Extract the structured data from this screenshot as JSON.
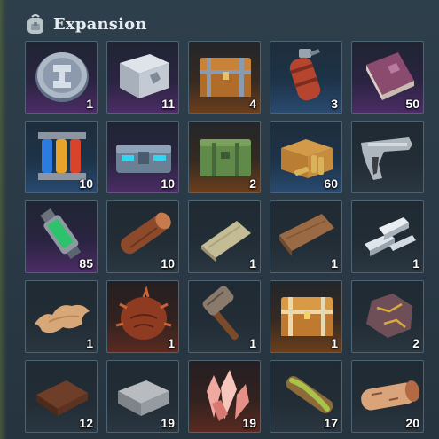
{
  "header": {
    "title": "Expansion",
    "icon": "backpack-icon"
  },
  "items": [
    {
      "name": "platinum-coin",
      "icon": "coin-icon",
      "qty": "1",
      "rarity": "purple"
    },
    {
      "name": "metal-supply-crate",
      "icon": "metal-crate-icon",
      "qty": "11",
      "rarity": "purple"
    },
    {
      "name": "wooden-chest",
      "icon": "wooden-chest-icon",
      "qty": "4",
      "rarity": "orange"
    },
    {
      "name": "grenade",
      "icon": "grenade-icon",
      "qty": "3",
      "rarity": "blue"
    },
    {
      "name": "book",
      "icon": "book-icon",
      "qty": "50",
      "rarity": "purple"
    },
    {
      "name": "energy-cells",
      "icon": "energy-cells-icon",
      "qty": "10",
      "rarity": "blue"
    },
    {
      "name": "tech-case",
      "icon": "tech-case-icon",
      "qty": "10",
      "rarity": "purple"
    },
    {
      "name": "military-ammo-box",
      "icon": "military-box-icon",
      "qty": "2",
      "rarity": "orange"
    },
    {
      "name": "ammo-carton",
      "icon": "ammo-box-icon",
      "qty": "60",
      "rarity": "blue"
    },
    {
      "name": "pistol",
      "icon": "pistol-icon",
      "qty": "",
      "rarity": "grey"
    },
    {
      "name": "stim-injector",
      "icon": "injector-icon",
      "qty": "85",
      "rarity": "purple"
    },
    {
      "name": "log",
      "icon": "log-icon",
      "qty": "10",
      "rarity": "grey"
    },
    {
      "name": "cloth-bundle",
      "icon": "cloth-icon",
      "qty": "1",
      "rarity": "grey"
    },
    {
      "name": "wood-plank",
      "icon": "plank-icon",
      "qty": "1",
      "rarity": "grey"
    },
    {
      "name": "metal-ingots",
      "icon": "ingots-icon",
      "qty": "1",
      "rarity": "grey"
    },
    {
      "name": "leather-hide",
      "icon": "hide-icon",
      "qty": "1",
      "rarity": "grey"
    },
    {
      "name": "spiked-seed",
      "icon": "seed-icon",
      "qty": "1",
      "rarity": "red"
    },
    {
      "name": "war-hammer",
      "icon": "hammer-icon",
      "qty": "1",
      "rarity": "grey"
    },
    {
      "name": "golden-chest",
      "icon": "golden-chest-icon",
      "qty": "1",
      "rarity": "orange"
    },
    {
      "name": "gold-ore",
      "icon": "ore-icon",
      "qty": "2",
      "rarity": "grey"
    },
    {
      "name": "wooden-board",
      "icon": "board-icon",
      "qty": "12",
      "rarity": "grey"
    },
    {
      "name": "stone-brick",
      "icon": "brick-icon",
      "qty": "19",
      "rarity": "grey"
    },
    {
      "name": "crystal-cluster",
      "icon": "crystal-icon",
      "qty": "19",
      "rarity": "red"
    },
    {
      "name": "mossy-branch",
      "icon": "branch-icon",
      "qty": "17",
      "rarity": "grey"
    },
    {
      "name": "birch-log",
      "icon": "birch-log-icon",
      "qty": "20",
      "rarity": "grey"
    }
  ]
}
